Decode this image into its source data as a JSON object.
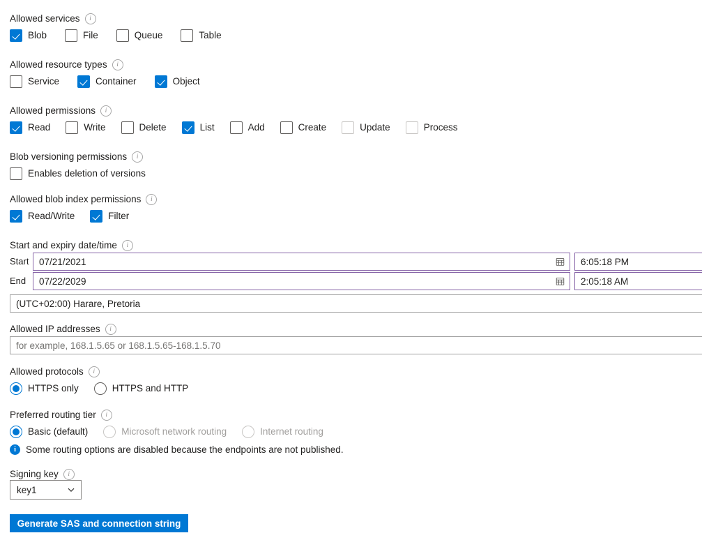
{
  "sections": {
    "allowed_services": {
      "label": "Allowed services",
      "info_icon": "info-circle-icon",
      "options": [
        {
          "label": "Blob",
          "checked": true,
          "disabled": false
        },
        {
          "label": "File",
          "checked": false,
          "disabled": false
        },
        {
          "label": "Queue",
          "checked": false,
          "disabled": false
        },
        {
          "label": "Table",
          "checked": false,
          "disabled": false
        }
      ]
    },
    "allowed_resource_types": {
      "label": "Allowed resource types",
      "info_icon": "info-circle-icon",
      "options": [
        {
          "label": "Service",
          "checked": false,
          "disabled": false
        },
        {
          "label": "Container",
          "checked": true,
          "disabled": false
        },
        {
          "label": "Object",
          "checked": true,
          "disabled": false
        }
      ]
    },
    "allowed_permissions": {
      "label": "Allowed permissions",
      "info_icon": "info-circle-icon",
      "options": [
        {
          "label": "Read",
          "checked": true,
          "disabled": false
        },
        {
          "label": "Write",
          "checked": false,
          "disabled": false
        },
        {
          "label": "Delete",
          "checked": false,
          "disabled": false
        },
        {
          "label": "List",
          "checked": true,
          "disabled": false
        },
        {
          "label": "Add",
          "checked": false,
          "disabled": false
        },
        {
          "label": "Create",
          "checked": false,
          "disabled": false
        },
        {
          "label": "Update",
          "checked": false,
          "disabled": true
        },
        {
          "label": "Process",
          "checked": false,
          "disabled": true
        }
      ]
    },
    "blob_versioning_permissions": {
      "label": "Blob versioning permissions",
      "info_icon": "info-circle-icon",
      "options": [
        {
          "label": "Enables deletion of versions",
          "checked": false,
          "disabled": false
        }
      ]
    },
    "allowed_blob_index_permissions": {
      "label": "Allowed blob index permissions",
      "info_icon": "info-circle-icon",
      "options": [
        {
          "label": "Read/Write",
          "checked": true,
          "disabled": false
        },
        {
          "label": "Filter",
          "checked": true,
          "disabled": false
        }
      ]
    },
    "start_and_expiry": {
      "label": "Start and expiry date/time",
      "info_icon": "info-circle-icon",
      "start_label": "Start",
      "start_date": "07/21/2021",
      "start_time": "6:05:18 PM",
      "end_label": "End",
      "end_date": "07/22/2029",
      "end_time": "2:05:18 AM",
      "timezone": "(UTC+02:00) Harare, Pretoria",
      "calendar_icon": "calendar-icon"
    },
    "allowed_ip_addresses": {
      "label": "Allowed IP addresses",
      "info_icon": "info-circle-icon",
      "value": "",
      "placeholder": "for example, 168.1.5.65 or 168.1.5.65-168.1.5.70"
    },
    "allowed_protocols": {
      "label": "Allowed protocols",
      "info_icon": "info-circle-icon",
      "options": [
        {
          "label": "HTTPS only",
          "selected": true,
          "disabled": false
        },
        {
          "label": "HTTPS and HTTP",
          "selected": false,
          "disabled": false
        }
      ]
    },
    "preferred_routing_tier": {
      "label": "Preferred routing tier",
      "info_icon": "info-circle-icon",
      "options": [
        {
          "label": "Basic (default)",
          "selected": true,
          "disabled": false
        },
        {
          "label": "Microsoft network routing",
          "selected": false,
          "disabled": true
        },
        {
          "label": "Internet routing",
          "selected": false,
          "disabled": true
        }
      ],
      "message": "Some routing options are disabled because the endpoints are not published.",
      "message_icon": "info-filled-icon"
    },
    "signing_key": {
      "label": "Signing key",
      "info_icon": "info-circle-icon",
      "value": "key1",
      "chevron_icon": "chevron-down-icon"
    }
  },
  "actions": {
    "generate_label": "Generate SAS and connection string"
  },
  "colors": {
    "accent": "#0078d4",
    "modified_border": "#8764a8",
    "disabled_text": "#a19f9d"
  }
}
